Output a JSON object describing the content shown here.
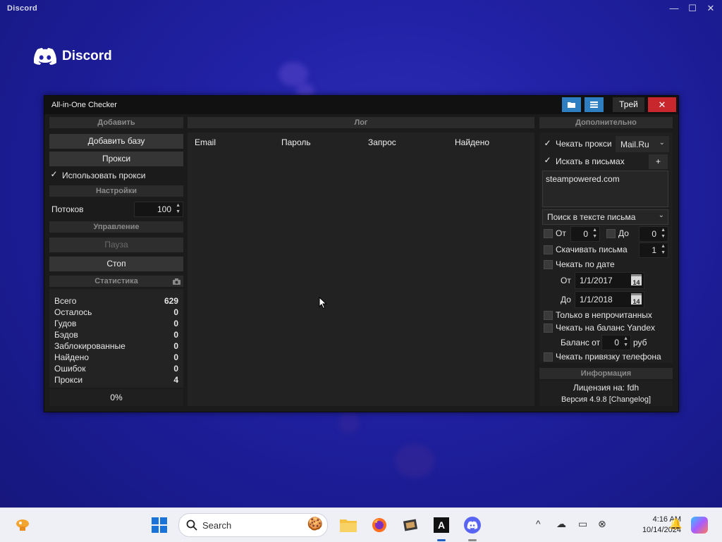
{
  "discord": {
    "window_title": "Discord",
    "brand": "Discord",
    "controls": {
      "minimize": "—",
      "maximize": "☐",
      "close": "✕"
    }
  },
  "app": {
    "title": "All-in-One Checker",
    "tray_label": "Трей",
    "close_glyph": "✕",
    "add_section": {
      "header": "Добавить",
      "add_base": "Добавить базу",
      "proxy": "Прокси",
      "use_proxy": "Использовать прокси",
      "use_proxy_checked": true
    },
    "settings_section": {
      "header": "Настройки",
      "threads_label": "Потоков",
      "threads_value": "100"
    },
    "control_section": {
      "header": "Управление",
      "pause": "Пауза",
      "stop": "Стоп"
    },
    "stats_section": {
      "header": "Статистика",
      "rows": [
        {
          "label": "Всего",
          "value": "629"
        },
        {
          "label": "Осталось",
          "value": "0"
        },
        {
          "label": "Гудов",
          "value": "0"
        },
        {
          "label": "Бэдов",
          "value": "0"
        },
        {
          "label": "Заблокированные",
          "value": "0"
        },
        {
          "label": "Найдено",
          "value": "0"
        },
        {
          "label": "Ошибок",
          "value": "0"
        },
        {
          "label": "Прокси",
          "value": "4"
        }
      ],
      "progress": "0%"
    },
    "log_section": {
      "header": "Лог",
      "columns": [
        "Email",
        "Пароль",
        "Запрос",
        "Найдено"
      ]
    },
    "extra_section": {
      "header": "Дополнительно",
      "check_proxy": "Чекать прокси",
      "check_proxy_checked": true,
      "provider": "Mail.Ru",
      "search_in_letters": "Искать в письмах",
      "search_in_letters_checked": true,
      "plus": "+",
      "search_query": "steampowered.com",
      "search_mode": "Поиск в тексте письма",
      "from_label": "От",
      "from_value": "0",
      "to_label": "До",
      "to_value": "0",
      "download_letters": "Скачивать письма",
      "download_value": "1",
      "check_by_date": "Чекать по дате",
      "date_from_label": "От",
      "date_from": "1/1/2017",
      "date_to_label": "До",
      "date_to": "1/1/2018",
      "calendar_day": "14",
      "only_unread": "Только в непрочитанных",
      "check_yandex_balance": "Чекать на баланс Yandex",
      "balance_from": "Баланс от",
      "balance_value": "0",
      "currency": "руб",
      "check_phone": "Чекать привязку телефона"
    },
    "info_section": {
      "header": "Информация",
      "license": "Лицензия на: fdh",
      "version": "Версия 4.9.8 [Changelog]"
    }
  },
  "taskbar": {
    "search_placeholder": "Search",
    "time": "4:16 AM",
    "date": "10/14/2024"
  }
}
